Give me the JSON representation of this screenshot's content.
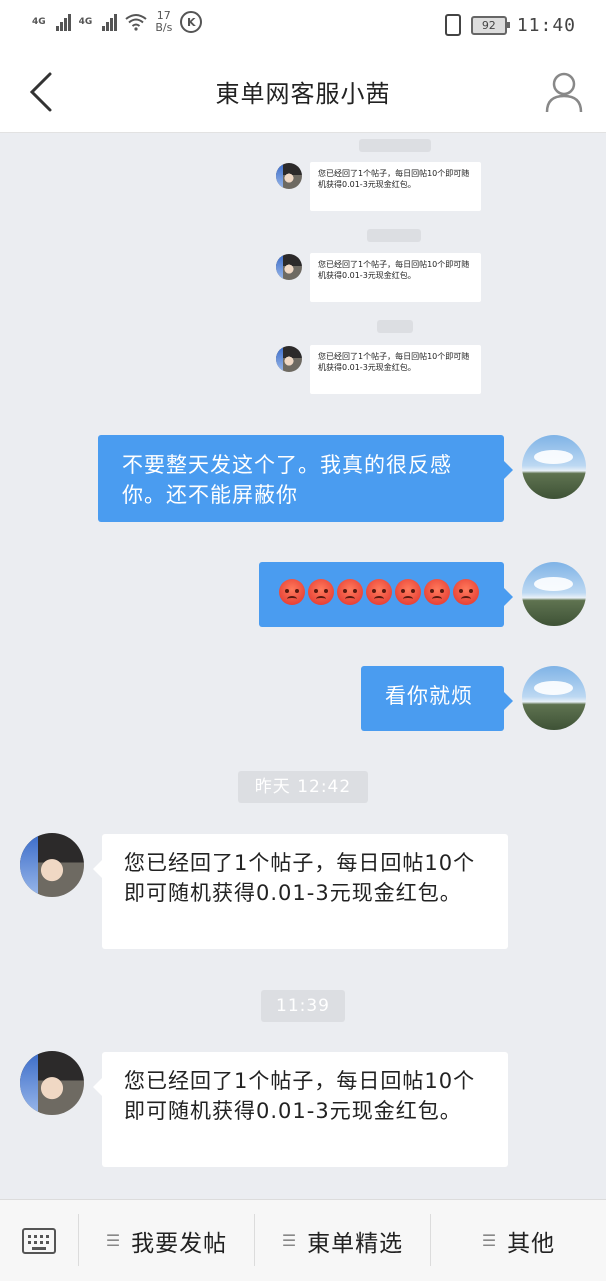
{
  "status_bar": {
    "network1": "4G",
    "network2": "4G",
    "speed_value": "17",
    "speed_unit": "B/s",
    "k_badge": "K",
    "battery": "92",
    "time": "11:40"
  },
  "header": {
    "title": "東单网客服小茜"
  },
  "messages": {
    "tiny_text": "您已经回了1个帖子，每日回帖10个即可随机获得0.01-3元现金红包。",
    "me1": "不要整天发这个了。我真的很反感你。还不能屏蔽你",
    "me2_emoji_count": 7,
    "me3": "看你就烦",
    "stamp1": "昨天 12:42",
    "them1": "您已经回了1个帖子，每日回帖10个即可随机获得0.01-3元现金红包。",
    "stamp2": "11:39",
    "them2": "您已经回了1个帖子，每日回帖10个即可随机获得0.01-3元现金红包。"
  },
  "bottom_menu": {
    "items": [
      {
        "label": "我要发帖"
      },
      {
        "label": "東单精选"
      },
      {
        "label": "其他"
      }
    ]
  },
  "colors": {
    "my_bubble": "#4a9cf0",
    "background": "#ebedf1"
  }
}
